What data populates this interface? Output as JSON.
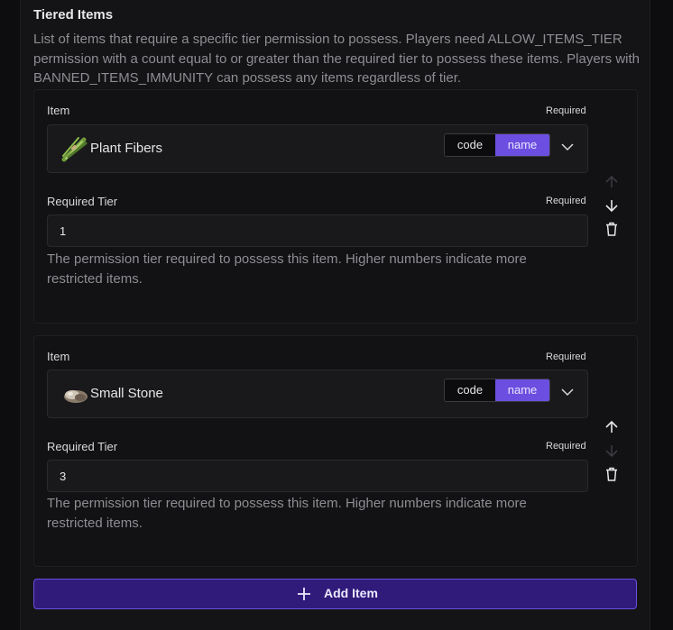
{
  "section": {
    "title": "Tiered Items",
    "description": "List of items that require a specific tier permission to possess. Players need ALLOW_ITEMS_TIER permission with a count equal to or greater than the required tier to possess these items. Players with BANNED_ITEMS_IMMUNITY can possess any items regardless of tier."
  },
  "items": [
    {
      "item_label": "Item",
      "item_required": "Required",
      "item_name": "Plant Fibers",
      "item_icon": "plant-fibers-icon",
      "toggle_code": "code",
      "toggle_name": "name",
      "tier_label": "Required Tier",
      "tier_required": "Required",
      "tier_value": "1",
      "help": "The permission tier required to possess this item. Higher numbers indicate more restricted items."
    },
    {
      "item_label": "Item",
      "item_required": "Required",
      "item_name": "Small Stone",
      "item_icon": "small-stone-icon",
      "toggle_code": "code",
      "toggle_name": "name",
      "tier_label": "Required Tier",
      "tier_required": "Required",
      "tier_value": "3",
      "help": "The permission tier required to possess this item. Higher numbers indicate more restricted items."
    }
  ],
  "add_button": {
    "label": "Add Item"
  },
  "colors": {
    "accent": "#6c4fe0",
    "button_bg": "#311b7a",
    "background": "#141416"
  }
}
